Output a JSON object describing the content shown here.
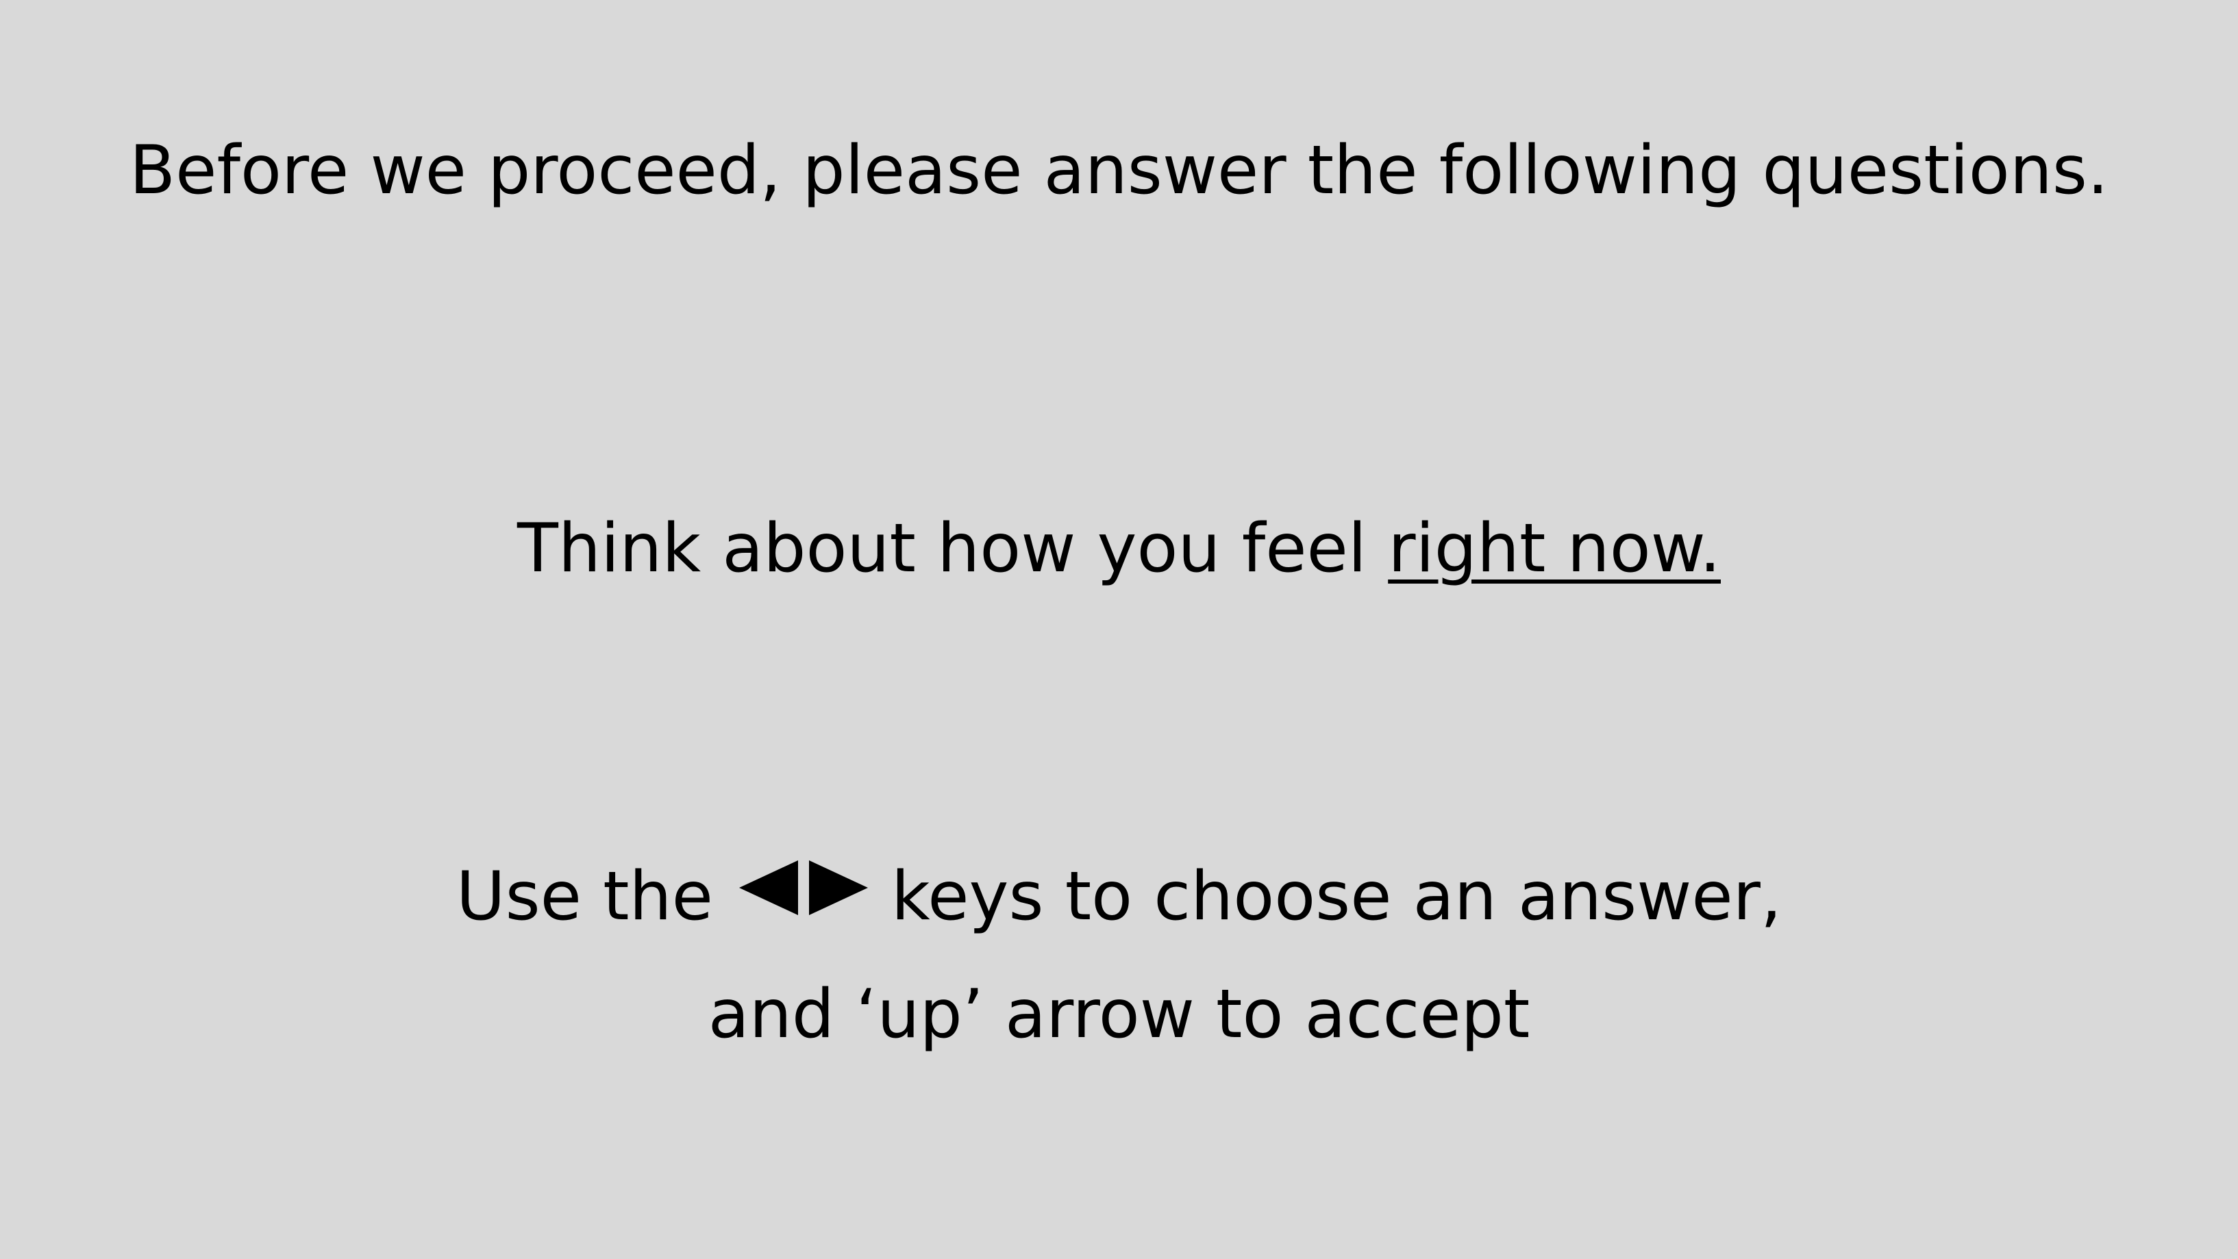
{
  "screen": {
    "background_color": "#d9d9d9",
    "text_color": "#000000",
    "intro_text": "Before we proceed, please answer the following questions.",
    "think_prefix": "Think about how you feel ",
    "think_emphasis": "right now.",
    "keys_prefix": "Use the",
    "keys_suffix": "keys to choose an answer,",
    "keys_line2": "and ‘up’ arrow to accept",
    "icons": [
      "left-arrow-icon",
      "right-arrow-icon"
    ]
  }
}
